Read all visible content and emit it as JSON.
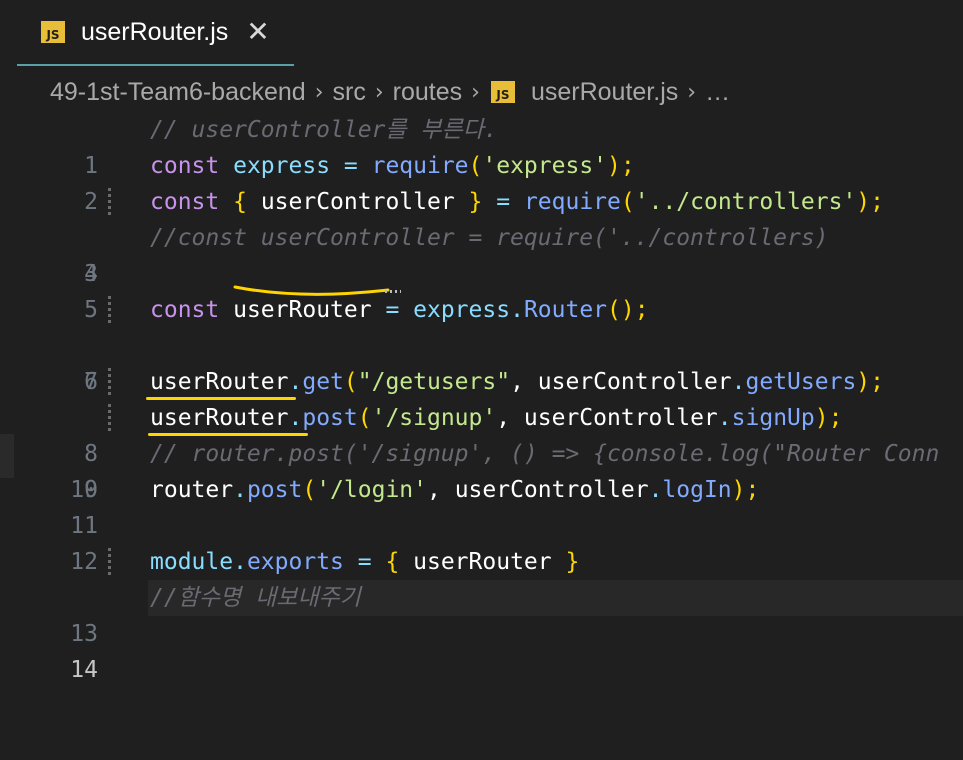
{
  "tab": {
    "icon": "js-file-icon",
    "icon_text": "JS",
    "title": "userRouter.js",
    "close": "✕"
  },
  "breadcrumb": {
    "items": [
      "49-1st-Team6-backend",
      "src",
      "routes",
      "userRouter.js",
      "…"
    ],
    "separator": "›"
  },
  "editor": {
    "line_numbers": [
      "1",
      "2",
      "3",
      "4",
      "5",
      "6",
      "7",
      "8",
      "9",
      "10",
      "11",
      "12",
      "13",
      "14"
    ],
    "active_line": "14",
    "lines": {
      "l1": {
        "comment": "// userController를 부른다."
      },
      "l2": {
        "kw": "const",
        "var": "express",
        "eq": " = ",
        "fn": "require",
        "open": "(",
        "str": "'express'",
        "close": ");"
      },
      "l3": {
        "kw": "const",
        "lb": "{",
        "var": " userController ",
        "rb": "}",
        "eq": " = ",
        "fn": "require",
        "open": "(",
        "str": "'../controllers'",
        "close": ");"
      },
      "l4": {
        "comment": "//const userController = require('../controllers)"
      },
      "l6": {
        "kw": "const",
        "var": "userRouter",
        "eq": " = ",
        "obj": "express",
        "dot": ".",
        "fn": "Router",
        "call": "();"
      },
      "l8": {
        "obj": "userRouter",
        "dot": ".",
        "fn": "get",
        "open": "(",
        "str": "\"/getusers\"",
        "comma": ", ",
        "obj2": "userController",
        "dot2": ".",
        "fn2": "getUsers",
        "close": ");"
      },
      "l9": {
        "obj": "userRouter",
        "dot": ".",
        "fn": "post",
        "open": "(",
        "str": "'/signup'",
        "comma": ", ",
        "obj2": "userController",
        "dot2": ".",
        "fn2": "signUp",
        "close": ");"
      },
      "l10": {
        "comment": "// router.post('/signup', () => {console.log(\"Router Conn"
      },
      "l11": {
        "obj": "router",
        "dot": ".",
        "fn": "post",
        "open": "(",
        "str": "'/login'",
        "comma": ", ",
        "obj2": "userController",
        "dot2": ".",
        "fn2": "logIn",
        "close": ");"
      },
      "l13": {
        "obj": "module",
        "dot": ".",
        "prop": "exports",
        "eq": " = ",
        "lb": "{",
        "var": " userRouter ",
        "rb": "}"
      },
      "l14": {
        "comment": "//함수명 내보내주기"
      }
    }
  },
  "colors": {
    "background": "#1f1f1f",
    "tab_underline": "#5aa0a8",
    "js_icon": "#e8bd38",
    "highlight_underline": "#ffd400",
    "keyword": "#c792ea",
    "variable": "#89ddff",
    "function": "#82aaff",
    "string": "#c3e88d",
    "comment": "#6a6a73",
    "bracket": "#ffd700"
  }
}
